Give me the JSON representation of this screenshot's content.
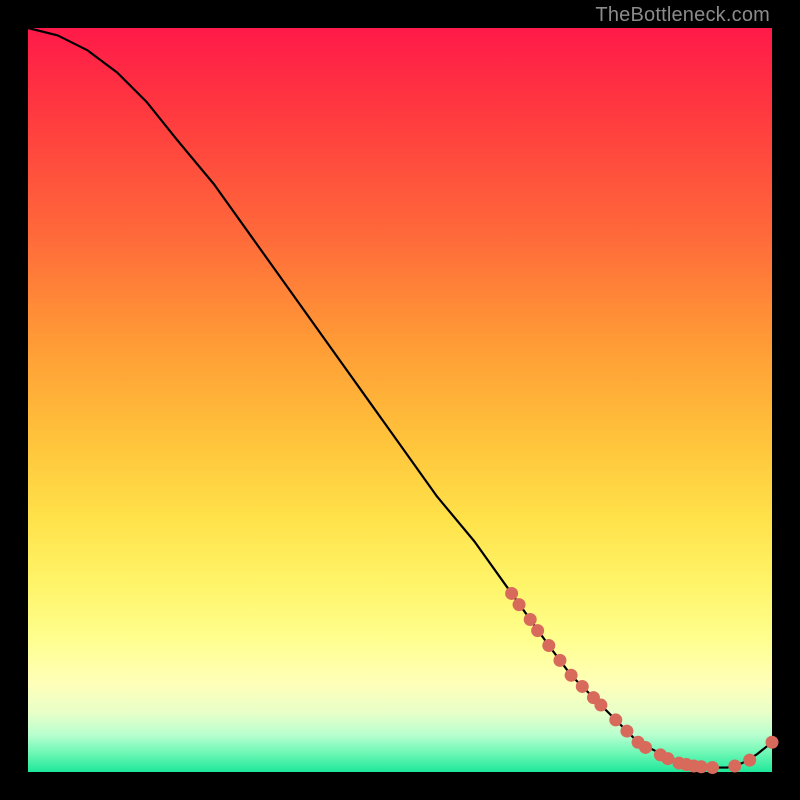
{
  "watermark": "TheBottleneck.com",
  "colors": {
    "gradient_top": "#ff1a49",
    "gradient_bottom": "#1ee89a",
    "curve": "#000000",
    "marker_fill": "#d86a5c",
    "marker_stroke": "#b45448"
  },
  "chart_data": {
    "type": "line",
    "title": "",
    "xlabel": "",
    "ylabel": "",
    "xlim": [
      0,
      100
    ],
    "ylim": [
      0,
      100
    ],
    "series": [
      {
        "name": "curve",
        "x": [
          0,
          4,
          8,
          12,
          16,
          20,
          25,
          30,
          35,
          40,
          45,
          50,
          55,
          60,
          65,
          70,
          73,
          76,
          78,
          80,
          82,
          84,
          86,
          88,
          90,
          92,
          94,
          96,
          98,
          100
        ],
        "y": [
          100,
          99,
          97,
          94,
          90,
          85,
          79,
          72,
          65,
          58,
          51,
          44,
          37,
          31,
          24,
          17,
          13,
          10,
          8,
          6,
          4,
          3,
          2,
          1.2,
          0.8,
          0.6,
          0.6,
          1.2,
          2.4,
          4
        ]
      }
    ],
    "markers": {
      "name": "highlighted-points",
      "points": [
        {
          "x": 65,
          "y": 24
        },
        {
          "x": 66,
          "y": 22.5
        },
        {
          "x": 67.5,
          "y": 20.5
        },
        {
          "x": 68.5,
          "y": 19
        },
        {
          "x": 70,
          "y": 17
        },
        {
          "x": 71.5,
          "y": 15
        },
        {
          "x": 73,
          "y": 13
        },
        {
          "x": 74.5,
          "y": 11.5
        },
        {
          "x": 76,
          "y": 10
        },
        {
          "x": 77,
          "y": 9
        },
        {
          "x": 79,
          "y": 7
        },
        {
          "x": 80.5,
          "y": 5.5
        },
        {
          "x": 82,
          "y": 4
        },
        {
          "x": 83,
          "y": 3.3
        },
        {
          "x": 85,
          "y": 2.3
        },
        {
          "x": 86,
          "y": 1.8
        },
        {
          "x": 87.5,
          "y": 1.2
        },
        {
          "x": 88.5,
          "y": 1
        },
        {
          "x": 89.5,
          "y": 0.8
        },
        {
          "x": 90.5,
          "y": 0.7
        },
        {
          "x": 92,
          "y": 0.6
        },
        {
          "x": 95,
          "y": 0.8
        },
        {
          "x": 97,
          "y": 1.6
        },
        {
          "x": 100,
          "y": 4
        }
      ]
    }
  }
}
